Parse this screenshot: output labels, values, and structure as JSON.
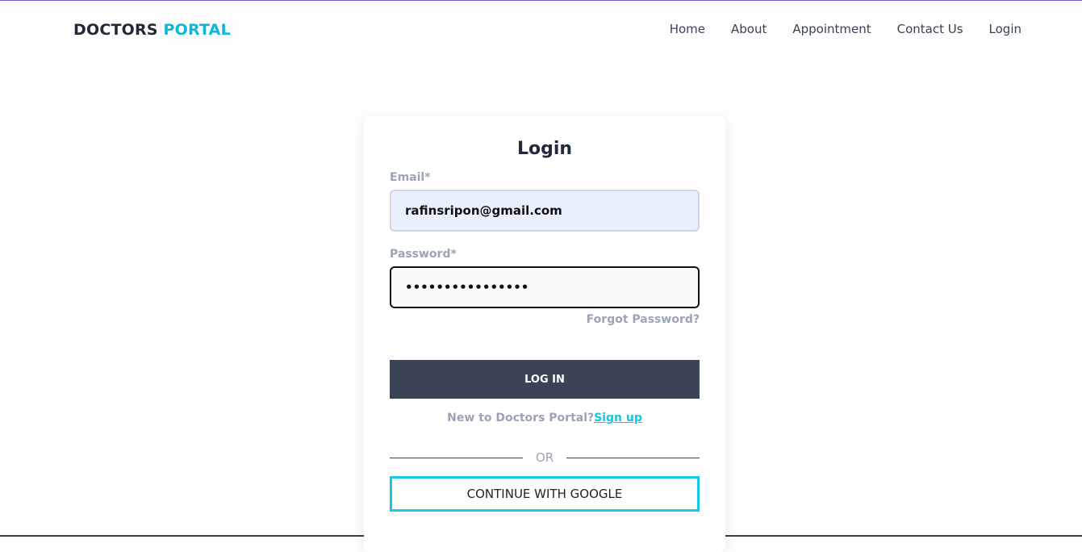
{
  "nav": {
    "logo_main": "DOCTORS",
    "logo_accent": "PORTAL",
    "items": [
      "Home",
      "About",
      "Appointment",
      "Contact Us",
      "Login"
    ]
  },
  "login": {
    "title": "Login",
    "email_label": "Email*",
    "email_value": "rafinsripon@gmail.com",
    "password_label": "Password*",
    "password_value": "••••••••••••••••",
    "forgot": "Forgot Password?",
    "submit": "LOG IN",
    "new_text": "New to Doctors Portal?",
    "signup": "Sign up",
    "or": "OR",
    "google": "CONTINUE WITH GOOGLE"
  },
  "colors": {
    "accent": "#0fb8d9",
    "button": "#3b4356"
  }
}
